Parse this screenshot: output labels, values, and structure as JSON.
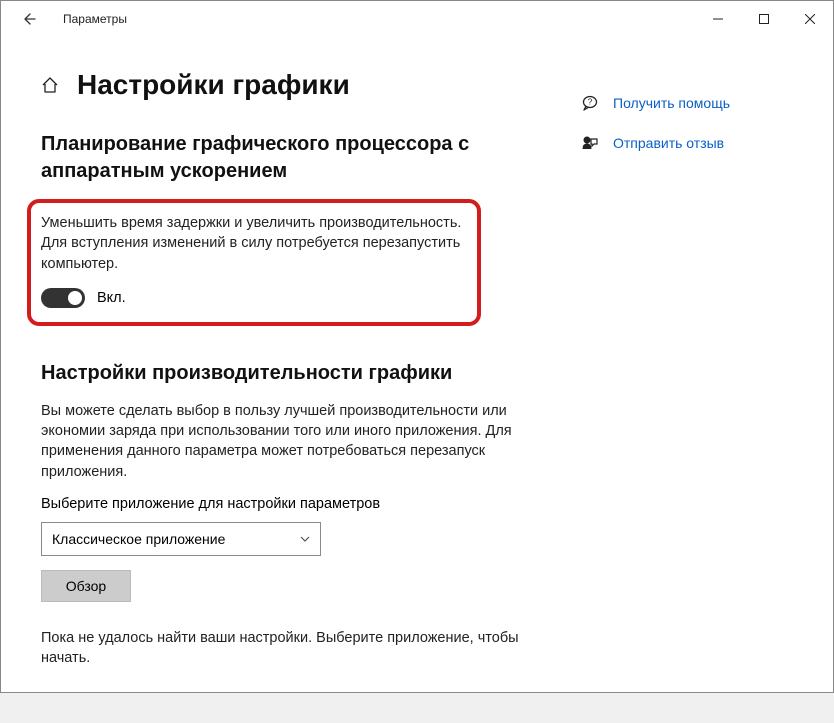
{
  "titlebar": {
    "title": "Параметры"
  },
  "page": {
    "heading": "Настройки графики"
  },
  "section1": {
    "title": "Планирование графического процессора с аппаратным ускорением",
    "desc": "Уменьшить время задержки и увеличить производительность. Для вступления изменений в силу потребуется перезапустить компьютер.",
    "toggle_label": "Вкл."
  },
  "section2": {
    "title": "Настройки производительности графики",
    "desc": "Вы можете сделать выбор в пользу лучшей производительности или экономии заряда при использовании того или иного приложения. Для применения данного параметра может потребоваться перезапуск приложения.",
    "select_label": "Выберите приложение для настройки параметров",
    "select_value": "Классическое приложение",
    "browse_label": "Обзор",
    "empty_state": "Пока не удалось найти ваши настройки. Выберите приложение, чтобы начать."
  },
  "side": {
    "help": "Получить помощь",
    "feedback": "Отправить отзыв"
  }
}
